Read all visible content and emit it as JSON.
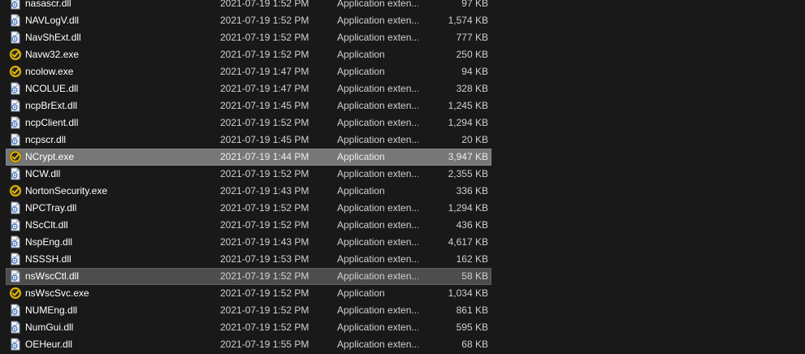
{
  "files": [
    {
      "name": "nasascr.dll",
      "date": "2021-07-19 1:52 PM",
      "type": "Application exten...",
      "size": "97 KB",
      "icon": "dll-file-icon",
      "state": ""
    },
    {
      "name": "NAVLogV.dll",
      "date": "2021-07-19 1:52 PM",
      "type": "Application exten...",
      "size": "1,574 KB",
      "icon": "dll-file-icon",
      "state": ""
    },
    {
      "name": "NavShExt.dll",
      "date": "2021-07-19 1:52 PM",
      "type": "Application exten...",
      "size": "777 KB",
      "icon": "dll-file-icon",
      "state": ""
    },
    {
      "name": "Navw32.exe",
      "date": "2021-07-19 1:52 PM",
      "type": "Application",
      "size": "250 KB",
      "icon": "norton-exe-icon",
      "state": ""
    },
    {
      "name": "ncolow.exe",
      "date": "2021-07-19 1:47 PM",
      "type": "Application",
      "size": "94 KB",
      "icon": "norton-exe-icon",
      "state": ""
    },
    {
      "name": "NCOLUE.dll",
      "date": "2021-07-19 1:47 PM",
      "type": "Application exten...",
      "size": "328 KB",
      "icon": "dll-file-icon",
      "state": ""
    },
    {
      "name": "ncpBrExt.dll",
      "date": "2021-07-19 1:45 PM",
      "type": "Application exten...",
      "size": "1,245 KB",
      "icon": "dll-file-icon",
      "state": ""
    },
    {
      "name": "ncpClient.dll",
      "date": "2021-07-19 1:52 PM",
      "type": "Application exten...",
      "size": "1,294 KB",
      "icon": "dll-file-icon",
      "state": ""
    },
    {
      "name": "ncpscr.dll",
      "date": "2021-07-19 1:45 PM",
      "type": "Application exten...",
      "size": "20 KB",
      "icon": "dll-file-icon",
      "state": ""
    },
    {
      "name": "NCrypt.exe",
      "date": "2021-07-19 1:44 PM",
      "type": "Application",
      "size": "3,947 KB",
      "icon": "norton-exe-icon",
      "state": "selected"
    },
    {
      "name": "NCW.dll",
      "date": "2021-07-19 1:52 PM",
      "type": "Application exten...",
      "size": "2,355 KB",
      "icon": "dll-file-icon",
      "state": ""
    },
    {
      "name": "NortonSecurity.exe",
      "date": "2021-07-19 1:43 PM",
      "type": "Application",
      "size": "336 KB",
      "icon": "norton-exe-icon",
      "state": ""
    },
    {
      "name": "NPCTray.dll",
      "date": "2021-07-19 1:52 PM",
      "type": "Application exten...",
      "size": "1,294 KB",
      "icon": "dll-file-icon",
      "state": ""
    },
    {
      "name": "NScClt.dll",
      "date": "2021-07-19 1:52 PM",
      "type": "Application exten...",
      "size": "436 KB",
      "icon": "dll-file-icon",
      "state": ""
    },
    {
      "name": "NspEng.dll",
      "date": "2021-07-19 1:43 PM",
      "type": "Application exten...",
      "size": "4,617 KB",
      "icon": "dll-file-icon",
      "state": ""
    },
    {
      "name": "NSSSH.dll",
      "date": "2021-07-19 1:53 PM",
      "type": "Application exten...",
      "size": "162 KB",
      "icon": "dll-file-icon",
      "state": ""
    },
    {
      "name": "nsWscCtl.dll",
      "date": "2021-07-19 1:52 PM",
      "type": "Application exten...",
      "size": "58 KB",
      "icon": "dll-file-icon",
      "state": "hover"
    },
    {
      "name": "nsWscSvc.exe",
      "date": "2021-07-19 1:52 PM",
      "type": "Application",
      "size": "1,034 KB",
      "icon": "norton-exe-icon",
      "state": ""
    },
    {
      "name": "NUMEng.dll",
      "date": "2021-07-19 1:52 PM",
      "type": "Application exten...",
      "size": "861 KB",
      "icon": "dll-file-icon",
      "state": ""
    },
    {
      "name": "NumGui.dll",
      "date": "2021-07-19 1:52 PM",
      "type": "Application exten...",
      "size": "595 KB",
      "icon": "dll-file-icon",
      "state": ""
    },
    {
      "name": "OEHeur.dll",
      "date": "2021-07-19 1:55 PM",
      "type": "Application exten...",
      "size": "68 KB",
      "icon": "dll-file-icon",
      "state": ""
    }
  ]
}
